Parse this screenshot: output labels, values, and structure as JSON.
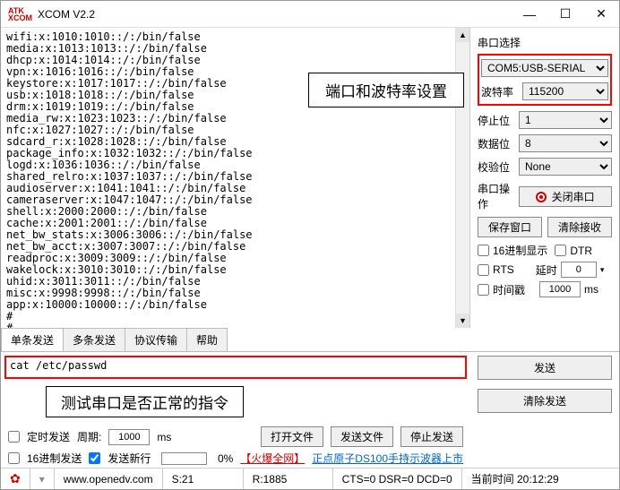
{
  "window": {
    "title": "XCOM V2.2",
    "logo_l1": "ATK",
    "logo_l2": "XCOM"
  },
  "terminal": "wifi:x:1010:1010::/:/bin/false\nmedia:x:1013:1013::/:/bin/false\ndhcp:x:1014:1014::/:/bin/false\nvpn:x:1016:1016::/:/bin/false\nkeystore:x:1017:1017::/:/bin/false\nusb:x:1018:1018::/:/bin/false\ndrm:x:1019:1019::/:/bin/false\nmedia_rw:x:1023:1023::/:/bin/false\nnfc:x:1027:1027::/:/bin/false\nsdcard_r:x:1028:1028::/:/bin/false\npackage_info:x:1032:1032::/:/bin/false\nlogd:x:1036:1036::/:/bin/false\nshared_relro:x:1037:1037::/:/bin/false\naudioserver:x:1041:1041::/:/bin/false\ncameraserver:x:1047:1047::/:/bin/false\nshell:x:2000:2000::/:/bin/false\ncache:x:2001:2001::/:/bin/false\nnet_bw_stats:x:3006:3006::/:/bin/false\nnet_bw_acct:x:3007:3007::/:/bin/false\nreadproc:x:3009:3009::/:/bin/false\nwakelock:x:3010:3010::/:/bin/false\nuhid:x:3011:3011::/:/bin/false\nmisc:x:9998:9998::/:/bin/false\napp:x:10000:10000::/:/bin/false\n#\n#",
  "annot1": "端口和波特率设置",
  "rpanel": {
    "group": "串口选择",
    "port": "COM5:USB-SERIAL",
    "baud_label": "波特率",
    "baud": "115200",
    "stop_label": "停止位",
    "stop": "1",
    "data_label": "数据位",
    "data": "8",
    "parity_label": "校验位",
    "parity": "None",
    "op_label": "串口操作",
    "op_btn": "关闭串口",
    "save_win": "保存窗口",
    "clear_recv": "清除接收",
    "hex_disp": "16进制显示",
    "dtr": "DTR",
    "rts": "RTS",
    "delay_label": "延时",
    "delay_val": "0",
    "ts": "时间戳",
    "ts_val": "1000",
    "ms": "ms"
  },
  "tabs": [
    "单条发送",
    "多条发送",
    "协议传输",
    "帮助"
  ],
  "send_input": "cat /etc/passwd",
  "annot2": "测试串口是否正常的指令",
  "send_btn": "发送",
  "clear_send": "清除发送",
  "bottom": {
    "timed": "定时发送",
    "period_label": "周期:",
    "period_val": "1000",
    "ms": "ms",
    "open_file": "打开文件",
    "send_file": "发送文件",
    "stop_send": "停止发送",
    "hex_send": "16进制发送",
    "newline": "发送新行",
    "pct": "0%",
    "link1": "【火爆全网】",
    "link2": "正点原子DS100手持示波器上市"
  },
  "status": {
    "site": "www.openedv.com",
    "s": "S:21",
    "r": "R:1885",
    "line": "CTS=0 DSR=0 DCD=0",
    "time_label": "当前时间",
    "time": "20:12:29"
  }
}
